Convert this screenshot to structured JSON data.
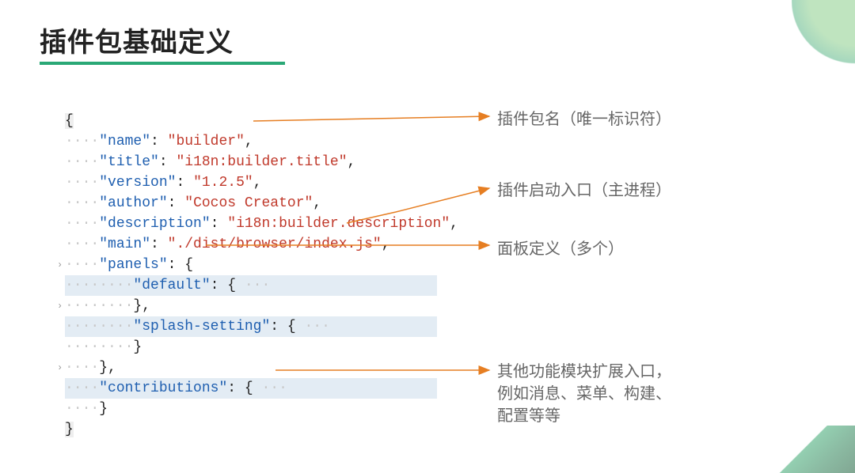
{
  "title": "插件包基础定义",
  "code": {
    "open_brace": "{",
    "close_brace": "}",
    "dots4": "····",
    "dots8": "········",
    "quote": "\"",
    "colon": ":",
    "comma": ",",
    "lines": {
      "name_key": "\"name\"",
      "name_val": "\"builder\"",
      "title_key": "\"title\"",
      "title_val": "\"i18n:builder.title\"",
      "version_key": "\"version\"",
      "version_val": "\"1.2.5\"",
      "author_key": "\"author\"",
      "author_val": "\"Cocos Creator\"",
      "description_key": "\"description\"",
      "description_val": "\"i18n:builder.description\"",
      "main_key": "\"main\"",
      "main_val": "\"./dist/browser/index.js\"",
      "panels_key": "\"panels\"",
      "panels_open": "{",
      "default_key": "\"default\"",
      "default_content": "{ ···",
      "splash_key": "\"splash-setting\"",
      "splash_content": "{ ···",
      "close_brace_row": "}",
      "close_brace_comma": "},",
      "contributions_key": "\"contributions\"",
      "contributions_content": "{ ···"
    },
    "fold_marker": "›"
  },
  "annotations": {
    "a1": "插件包名（唯一标识符）",
    "a2": "插件启动入口（主进程）",
    "a3": "面板定义（多个）",
    "a4": "其他功能模块扩展入口，\n例如消息、菜单、构建、\n配置等等"
  }
}
